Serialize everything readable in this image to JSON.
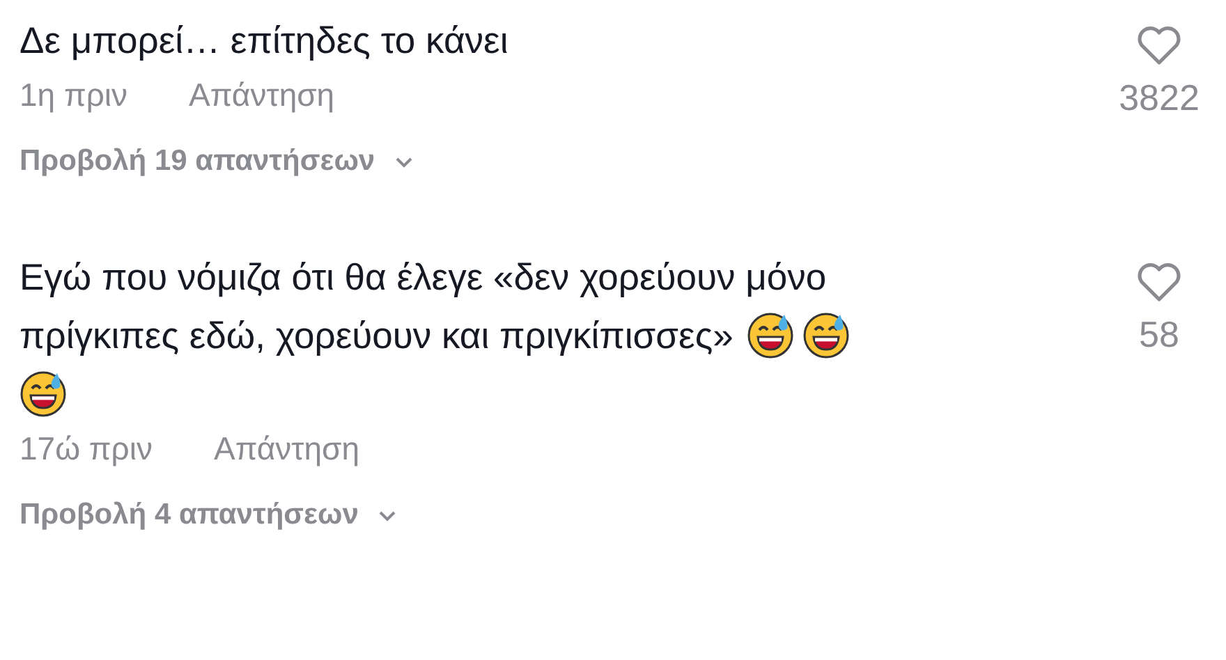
{
  "comments": [
    {
      "lines": [
        {
          "text": "Δε μπορεί… επίτηδες το κάνει"
        }
      ],
      "time": "1η πριν",
      "reply": "Απάντηση",
      "view_replies": "Προβολή 19 απαντήσεων",
      "likes": "3822"
    },
    {
      "lines": [
        {
          "text": "Εγώ που νόμιζα ότι θα έλεγε «δεν χορεύουν μόνο"
        },
        {
          "text": "πρίγκιπες εδώ, χορεύουν και πριγκίπισσες»",
          "emojis": [
            {
              "kind": "grin-sweat"
            },
            {
              "kind": "grin-sweat"
            }
          ]
        },
        {
          "emojis": [
            {
              "kind": "grin-sweat"
            }
          ]
        }
      ],
      "time": "17ώ πριν",
      "reply": "Απάντηση",
      "view_replies": "Προβολή 4 απαντήσεων",
      "likes": "58"
    }
  ]
}
